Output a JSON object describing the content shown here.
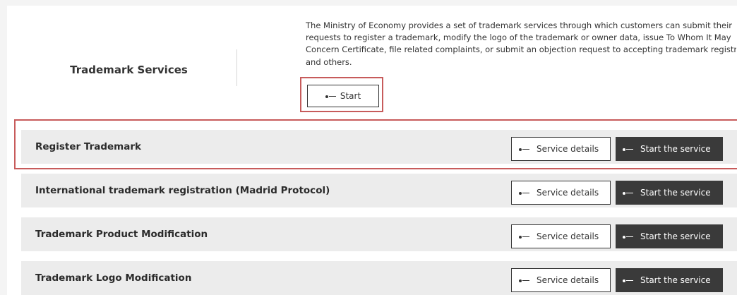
{
  "header": {
    "title": "Trademark Services",
    "description_lines": [
      "The Ministry of Economy provides a set of trademark services through which customers can submit their",
      "requests to register a trademark, modify the logo of the trademark or owner data, issue To Whom It May",
      "Concern Certificate, file related complaints, or submit an objection request to accepting trademark registration",
      "and others."
    ],
    "start_label": "Start"
  },
  "services": [
    {
      "title": "Register Trademark",
      "details_label": "Service details",
      "start_label": "Start the service"
    },
    {
      "title": "International trademark registration (Madrid Protocol)",
      "details_label": "Service details",
      "start_label": "Start the service"
    },
    {
      "title": "Trademark Product Modification",
      "details_label": "Service details",
      "start_label": "Start the service"
    },
    {
      "title": "Trademark Logo Modification",
      "details_label": "Service details",
      "start_label": "Start the service"
    }
  ],
  "icons": {
    "arrow": "arrow-left-icon"
  },
  "colors": {
    "highlight": "#c75b5b",
    "primary_button": "#3a3a3a",
    "row_bg": "#ececec"
  }
}
